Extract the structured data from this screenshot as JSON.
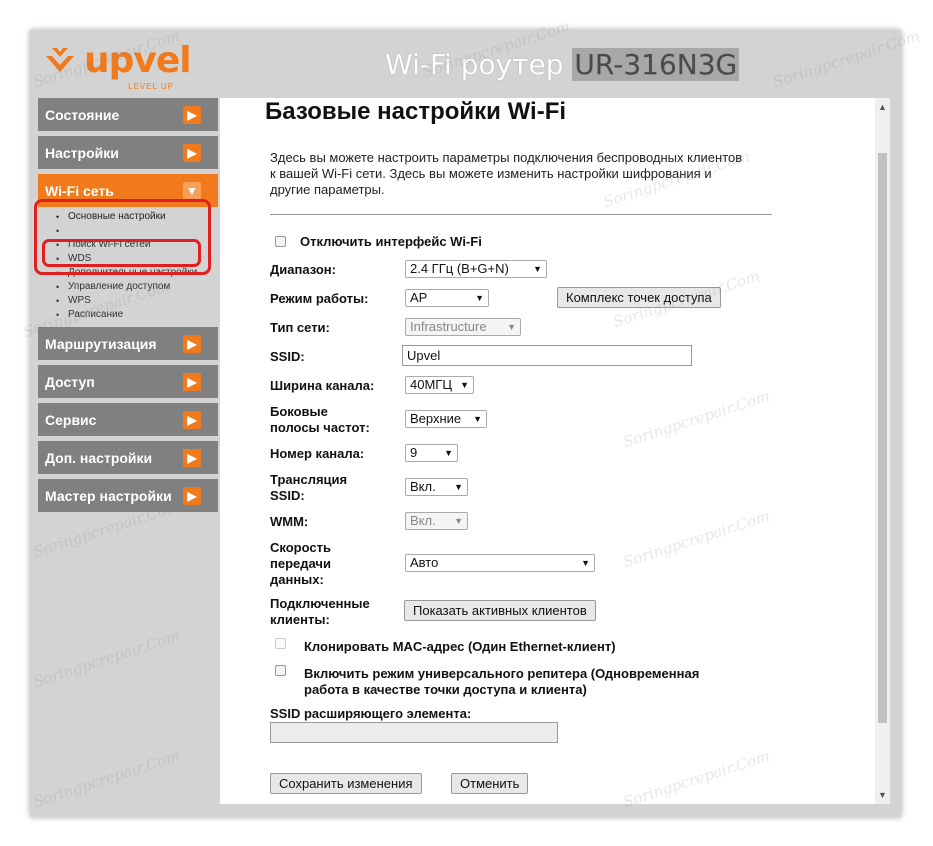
{
  "header": {
    "logo_text": "upvel",
    "logo_sub": "LEVEL UP",
    "title_prefix": "Wi-Fi роутер",
    "title_model": "UR-316N3G"
  },
  "sidebar": {
    "items": [
      {
        "label": "Состояние"
      },
      {
        "label": "Настройки"
      },
      {
        "label": "Wi-Fi сеть"
      },
      {
        "label": "Маршрутизация"
      },
      {
        "label": "Доступ"
      },
      {
        "label": "Сервис"
      },
      {
        "label": "Доп. настройки"
      },
      {
        "label": "Мастер настройки"
      }
    ],
    "submenu": [
      {
        "label": "Основные настройки"
      },
      {
        "label": "Поиск Wi-Fi сетей"
      },
      {
        "label": "WDS"
      },
      {
        "label": "Дополнительные настройки"
      },
      {
        "label": "Управление доступом"
      },
      {
        "label": "WPS"
      },
      {
        "label": "Расписание"
      }
    ],
    "arrow_right": "▶",
    "arrow_down": "▼"
  },
  "main": {
    "heading": "Базовые настройки Wi-Fi",
    "description": "Здесь вы можете настроить параметры подключения беспроводных клиентов к вашей Wi-Fi сети. Здесь вы можете изменить настройки шифрования и другие параметры.",
    "disable_wifi_label": "Отключить интерфейс Wi-Fi",
    "band_label": "Диапазон:",
    "band_value": "2.4 ГГц (B+G+N)",
    "mode_label": "Режим работы:",
    "mode_value": "AP",
    "ap_complex_button": "Комплекс точек доступа",
    "net_type_label": "Тип сети:",
    "net_type_value": "Infrastructure",
    "ssid_label": "SSID:",
    "ssid_value": "Upvel",
    "channel_width_label": "Ширина канала:",
    "channel_width_value": "40МГЦ",
    "sideband_label_1": "Боковые",
    "sideband_label_2": "полосы частот:",
    "sideband_value": "Верхние",
    "channel_label": "Номер канала:",
    "channel_value": "9",
    "ssid_broadcast_label_1": "Трансляция",
    "ssid_broadcast_label_2": "SSID:",
    "ssid_broadcast_value": "Вкл.",
    "wmm_label": "WMM:",
    "wmm_value": "Вкл.",
    "rate_label_1": "Скорость",
    "rate_label_2": "передачи",
    "rate_label_3": "данных:",
    "rate_value": "Авто",
    "clients_label_1": "Подключенные",
    "clients_label_2": "клиенты:",
    "show_clients_button": "Показать активных клиентов",
    "clone_mac_label": "Клонировать MAC-адрес (Один Ethernet-клиент)",
    "repeater_label_1": "Включить режим универсального репитера (Одновременная",
    "repeater_label_2": "работа в качестве точки доступа и клиента)",
    "ext_ssid_label": "SSID расширяющего элемента:",
    "ext_ssid_value": "",
    "save_button": "Сохранить изменения",
    "cancel_button": "Отменить",
    "caret": "▼"
  },
  "watermark": "Soringpcrepair.Com",
  "colors": {
    "accent": "#f07a1c",
    "nav": "#808080",
    "highlight": "#e02020"
  }
}
